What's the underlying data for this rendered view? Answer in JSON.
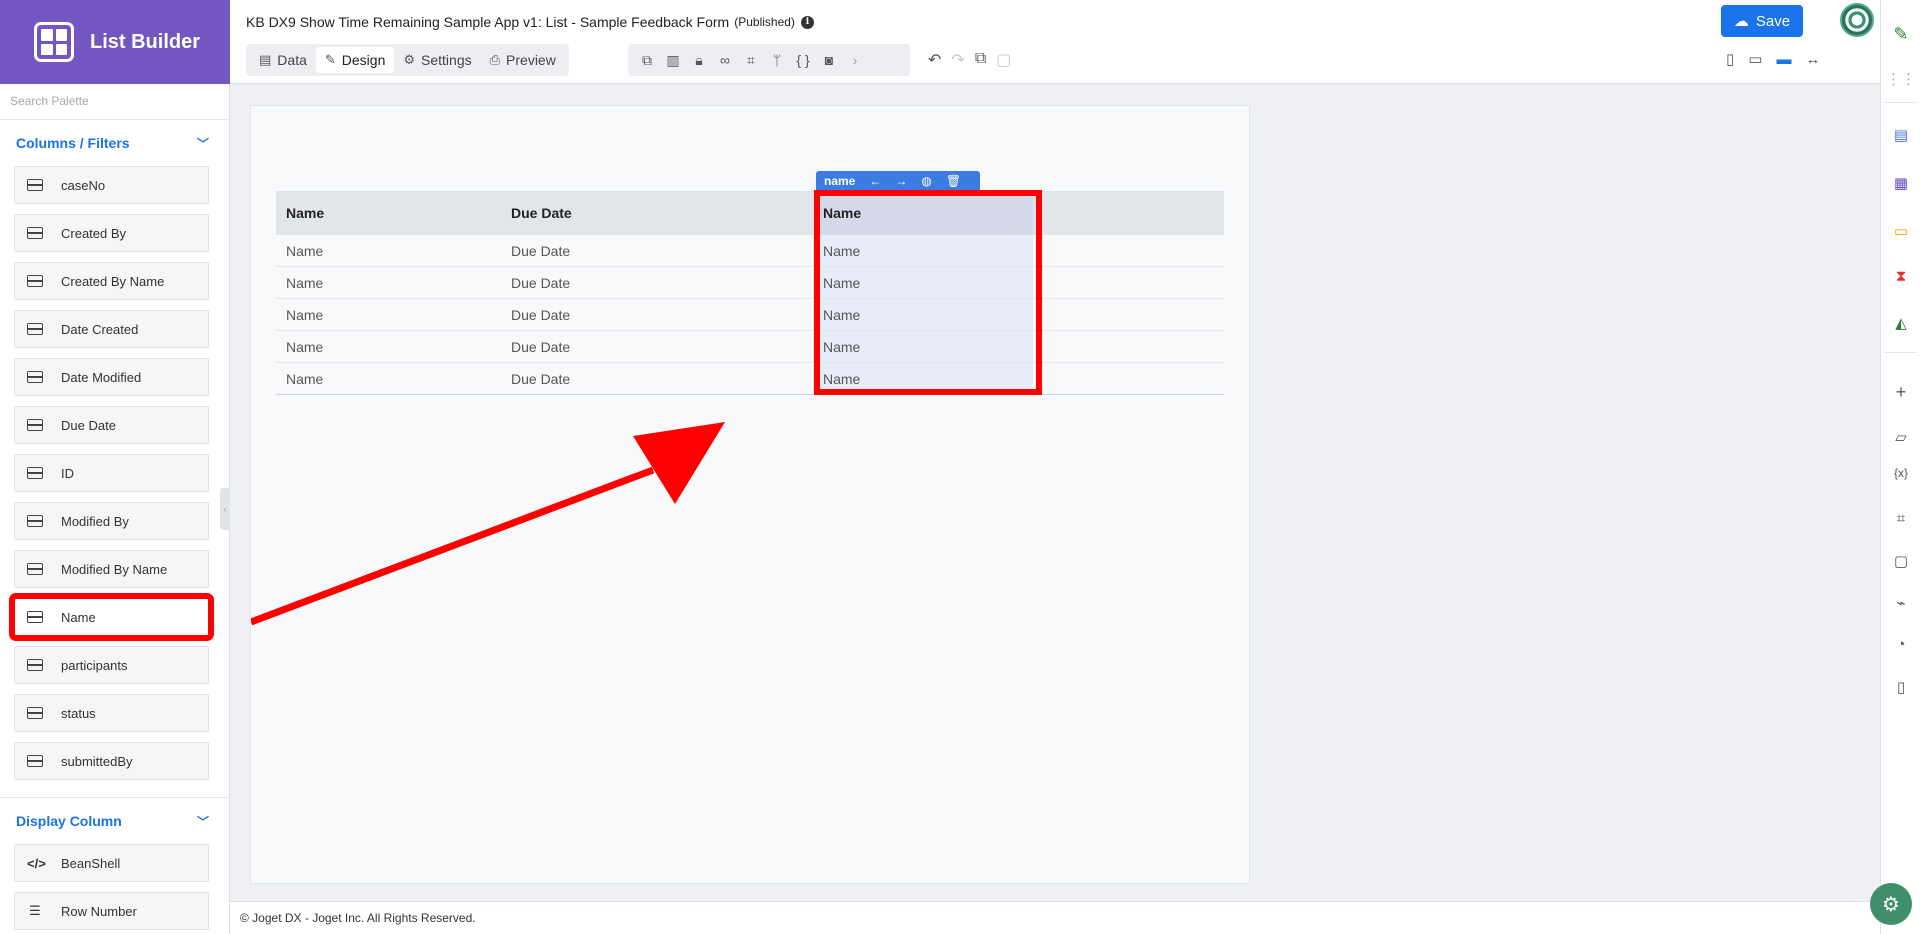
{
  "brand": {
    "title": "List Builder"
  },
  "header": {
    "app_title": "KB DX9 Show Time Remaining Sample App v1: List - Sample Feedback Form",
    "status": "(Published)",
    "info": "i",
    "tabs": [
      {
        "label": "Data",
        "icon": "table-icon"
      },
      {
        "label": "Design",
        "icon": "brush-icon"
      },
      {
        "label": "Settings",
        "icon": "gear-icon"
      },
      {
        "label": "Preview",
        "icon": "preview-icon"
      }
    ],
    "save_label": "Save"
  },
  "palette": {
    "search_placeholder": "Search Palette",
    "section1_title": "Columns / Filters",
    "columns": [
      "caseNo",
      "Created By",
      "Created By Name",
      "Date Created",
      "Date Modified",
      "Due Date",
      "ID",
      "Modified By",
      "Modified By Name",
      "Name",
      "participants",
      "status",
      "submittedBy"
    ],
    "section2_title": "Display Column",
    "display": [
      "BeanShell",
      "Row Number"
    ]
  },
  "canvas": {
    "column_toolbar_label": "name",
    "headers": [
      "Name",
      "Due Date",
      "Name"
    ],
    "rows": [
      [
        "Name",
        "Due Date",
        "Name"
      ],
      [
        "Name",
        "Due Date",
        "Name"
      ],
      [
        "Name",
        "Due Date",
        "Name"
      ],
      [
        "Name",
        "Due Date",
        "Name"
      ],
      [
        "Name",
        "Due Date",
        "Name"
      ]
    ]
  },
  "footer": {
    "text": "© Joget DX - Joget Inc. All Rights Reserved."
  },
  "colors": {
    "brand": "#7456c2",
    "accent": "#1a73e8",
    "highlight": "#ff0000"
  }
}
